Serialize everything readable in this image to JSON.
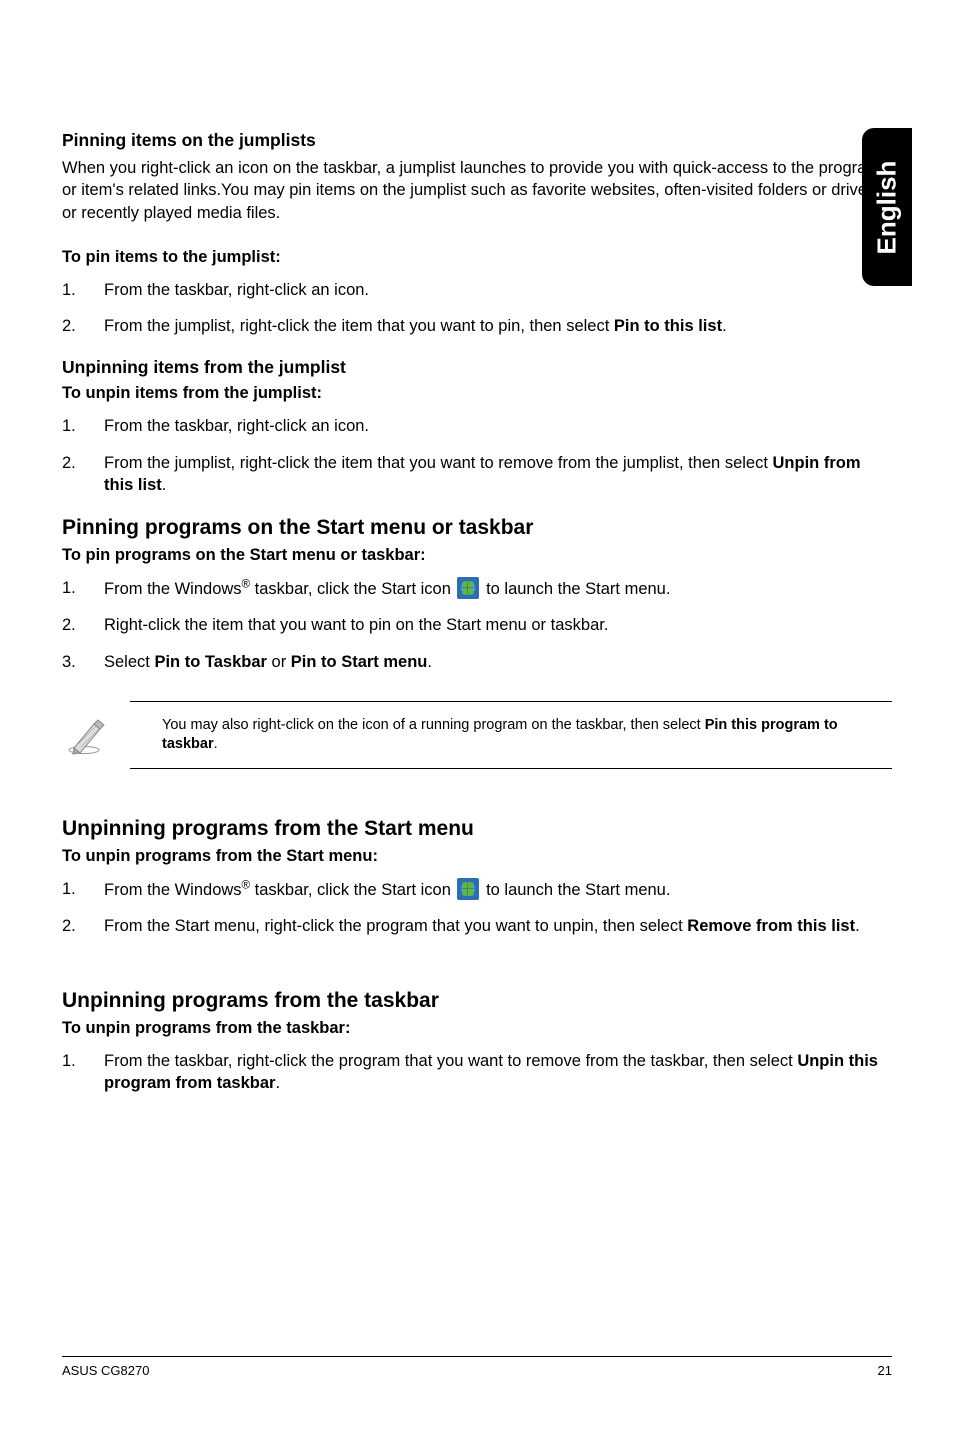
{
  "side_tab": "English",
  "s1": {
    "heading": "Pinning items on the jumplists",
    "intro": "When you right-click an icon on the taskbar, a jumplist launches to provide you with quick-access to the program's or item's related links.You may pin items on the jumplist such as favorite websites, often-visited folders or drives, or recently played media files.",
    "lead": "To pin items to the jumplist:",
    "items": [
      "From the taskbar, right-click an icon.",
      "From the jumplist, right-click the item that you want to pin, then select "
    ],
    "bold2": "Pin to this list"
  },
  "s2": {
    "heading": "Unpinning items from the jumplist",
    "lead": "To unpin items from the jumplist:",
    "items": [
      "From the taskbar, right-click an icon.",
      "From the jumplist, right-click the item that you want to remove from the jumplist, then select "
    ],
    "bold2": "Unpin from this list"
  },
  "s3": {
    "heading": "Pinning programs on the Start menu or taskbar",
    "lead": "To pin programs on the Start menu or taskbar:",
    "item1a": "From the Windows",
    "item1b": " taskbar, click the Start icon ",
    "item1c": " to launch the Start menu.",
    "item2": "Right-click the item that you want to pin on the Start menu or taskbar.",
    "item3a": "Select ",
    "item3b": "Pin to Taskbar",
    "item3c": " or ",
    "item3d": "Pin to Start menu"
  },
  "note": {
    "text_a": "You may also right-click on the icon of a running program on the taskbar, then select ",
    "text_b": "Pin this program to taskbar"
  },
  "s4": {
    "heading": "Unpinning programs from the Start menu",
    "lead": "To unpin programs from the Start menu:",
    "item1a": "From the Windows",
    "item1b": " taskbar, click the Start icon ",
    "item1c": " to launch the Start menu.",
    "item2a": "From the Start menu, right-click the program that you want to unpin, then select ",
    "item2b": "Remove from this list"
  },
  "s5": {
    "heading": "Unpinning programs from the taskbar",
    "lead": "To unpin programs from the taskbar:",
    "item1a": "From the taskbar, right-click the program that you want to remove from the taskbar, then select ",
    "item1b": "Unpin this program from taskbar"
  },
  "footer": {
    "left": "ASUS CG8270",
    "right": "21"
  }
}
